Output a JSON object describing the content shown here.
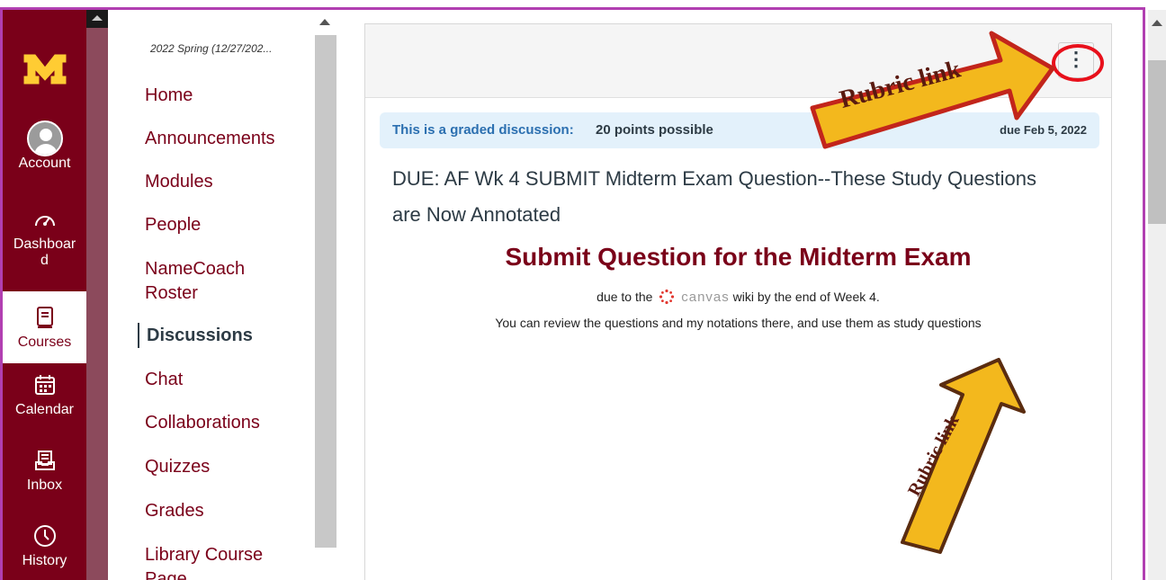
{
  "global_nav": {
    "items": [
      {
        "label": "Account",
        "icon": "avatar"
      },
      {
        "label": "Dashboard",
        "icon": "dashboard-icon"
      },
      {
        "label": "Courses",
        "icon": "courses-icon"
      },
      {
        "label": "Calendar",
        "icon": "calendar-icon"
      },
      {
        "label": "Inbox",
        "icon": "inbox-icon"
      },
      {
        "label": "History",
        "icon": "history-icon"
      }
    ],
    "label_lines": {
      "dashboard_1": "Dashboar",
      "dashboard_2": "d"
    }
  },
  "course_nav": {
    "term": "2022 Spring (12/27/202...",
    "items": [
      {
        "label": "Home"
      },
      {
        "label": "Announcements"
      },
      {
        "label": "Modules"
      },
      {
        "label": "People"
      },
      {
        "label": "NameCoach"
      },
      {
        "label": "Roster"
      },
      {
        "label": "Discussions"
      },
      {
        "label": "Chat"
      },
      {
        "label": "Collaborations"
      },
      {
        "label": "Quizzes"
      },
      {
        "label": "Grades"
      },
      {
        "label": "Library Course"
      },
      {
        "label": "Page"
      }
    ]
  },
  "main": {
    "graded_label": "This is a graded discussion:",
    "points": "20 points possible",
    "due_date": "due Feb 5, 2022",
    "title": "DUE: AF Wk 4 SUBMIT Midterm Exam Question--These Study Questions are Now Annotated",
    "heading": "Submit Question for the Midterm Exam",
    "due_prefix": "due to the",
    "canvas_word": "canvas",
    "due_suffix": "wiki by the end of Week 4.",
    "review_text": "You can review the questions and my notations there, and use them as study questions",
    "kebab": "⋮"
  },
  "annotations": {
    "arrow_top_label": "Rubric link",
    "arrow_bottom_label": "Rubric link"
  },
  "colors": {
    "brand_maroon": "#7a0019",
    "arrow_gold": "#f3b81d",
    "highlight_red": "#e8101b"
  }
}
